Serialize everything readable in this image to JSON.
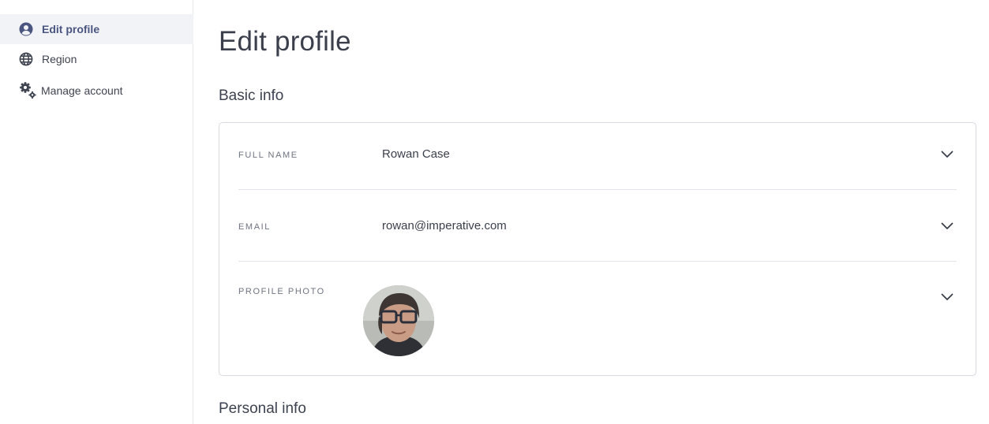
{
  "sidebar": {
    "items": [
      {
        "label": "Edit profile",
        "icon": "user-circle-icon",
        "active": true
      },
      {
        "label": "Region",
        "icon": "globe-icon",
        "active": false
      },
      {
        "label": "Manage account",
        "icon": "gears-icon",
        "active": false
      }
    ]
  },
  "main": {
    "title": "Edit profile",
    "sections": {
      "basic": {
        "title": "Basic info",
        "fields": [
          {
            "label": "FULL NAME",
            "value": "Rowan Case"
          },
          {
            "label": "EMAIL",
            "value": "rowan@imperative.com"
          },
          {
            "label": "PROFILE PHOTO"
          }
        ]
      },
      "personal": {
        "title": "Personal info"
      }
    }
  },
  "colors": {
    "accent": "#4a5580",
    "active_bg": "#f2f3f7",
    "border": "#d7dae0",
    "text": "#3a3f4b",
    "muted": "#6f7480"
  }
}
